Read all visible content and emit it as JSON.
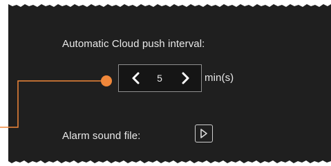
{
  "cloud_push": {
    "label": "Automatic Cloud push interval:",
    "value": "5",
    "unit": "min(s)"
  },
  "alarm_sound": {
    "label": "Alarm sound file:"
  },
  "colors": {
    "panel_background": "#1f1f1f",
    "callout_accent": "#f0873a",
    "text": "#e9e9e9"
  },
  "icons": [
    "chevron-left-icon",
    "chevron-right-icon",
    "play-icon"
  ]
}
